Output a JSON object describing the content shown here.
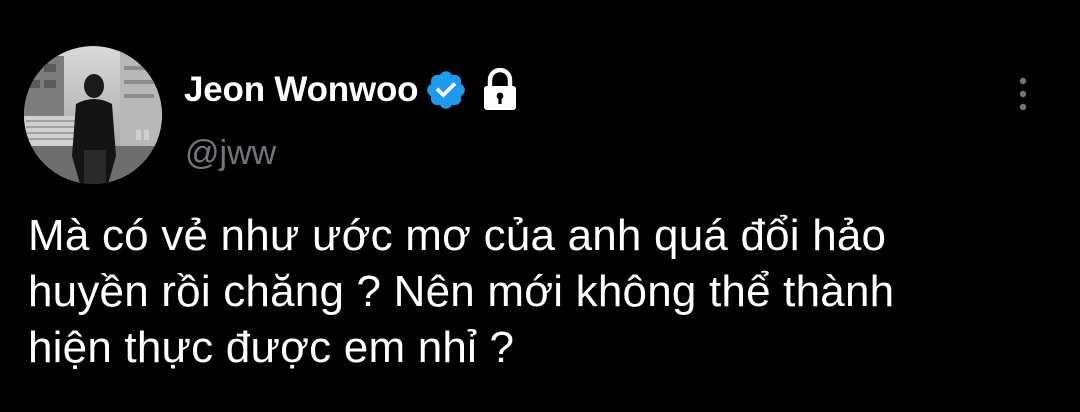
{
  "tweet": {
    "author": {
      "display_name": "Jeon Wonwoo",
      "handle": "@jww",
      "verified_icon": "verified-badge-icon",
      "protected_icon": "lock-icon",
      "avatar": "profile-photo"
    },
    "text": "Mà có vẻ như ước mơ của anh quá đổi hảo\nhuyền rồi chăng ? Nên mới không thể thành\nhiện thực được em nhỉ ?",
    "more_icon": "more-vertical-icon"
  },
  "colors": {
    "background": "#000000",
    "text_primary": "#ffffff",
    "text_secondary": "#71767b",
    "verified_blue": "#1d9bf0"
  }
}
